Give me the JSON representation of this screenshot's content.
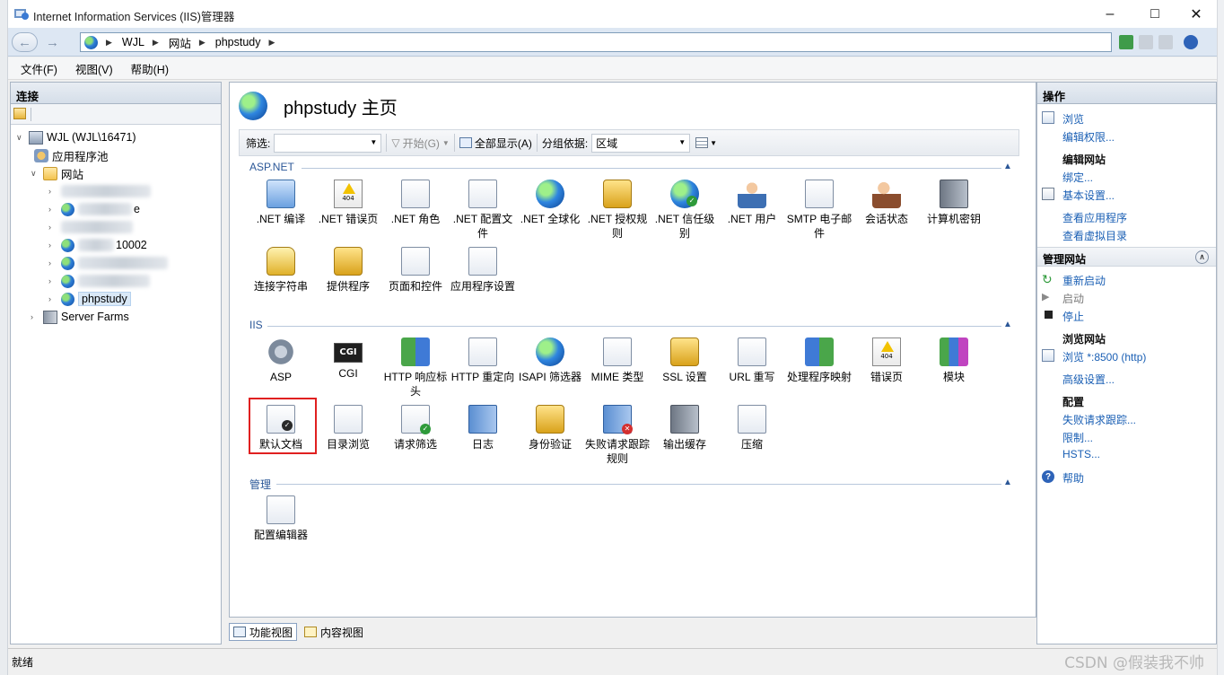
{
  "window": {
    "title": "Internet Information Services (IIS)管理器"
  },
  "address": {
    "crumbs": [
      "WJL",
      "网站",
      "phpstudy"
    ]
  },
  "menu": {
    "items": [
      "文件(F)",
      "视图(V)",
      "帮助(H)"
    ]
  },
  "connections": {
    "header": "连接",
    "server": "WJL (WJL\\16471)",
    "app_pools": "应用程序池",
    "sites": "网站",
    "site_partial_1": "e",
    "site_partial_2": "10002",
    "site_selected": "phpstudy",
    "server_farms": "Server Farms"
  },
  "center": {
    "title": "phpstudy 主页",
    "filter_label": "筛选:",
    "start_label": "开始(G)",
    "show_all_label": "全部显示(A)",
    "group_label": "分组依据:",
    "group_value": "区域",
    "sections": {
      "aspnet": "ASP.NET",
      "iis": "IIS",
      "manage": "管理"
    },
    "aspnet_features": [
      ".NET 编译",
      ".NET 错误页",
      ".NET 角色",
      ".NET 配置文件",
      ".NET 全球化",
      ".NET 授权规则",
      ".NET 信任级别",
      ".NET 用户",
      "SMTP 电子邮件",
      "会话状态",
      "计算机密钥",
      "连接字符串",
      "提供程序",
      "页面和控件",
      "应用程序设置"
    ],
    "iis_features": [
      "ASP",
      "CGI",
      "HTTP 响应标头",
      "HTTP 重定向",
      "ISAPI 筛选器",
      "MIME 类型",
      "SSL 设置",
      "URL 重写",
      "处理程序映射",
      "错误页",
      "模块",
      "默认文档",
      "目录浏览",
      "请求筛选",
      "日志",
      "身份验证",
      "失败请求跟踪规则",
      "输出缓存",
      "压缩"
    ],
    "manage_features": [
      "配置编辑器"
    ],
    "cgi_icon_text": "CGI"
  },
  "view_tabs": {
    "features": "功能视图",
    "content": "内容视图"
  },
  "actions": {
    "header": "操作",
    "browse": "浏览",
    "edit_permissions": "编辑权限...",
    "edit_site": "编辑网站",
    "bindings": "绑定...",
    "basic_settings": "基本设置...",
    "view_apps": "查看应用程序",
    "view_vdirs": "查看虚拟目录",
    "manage_site": "管理网站",
    "restart": "重新启动",
    "start": "启动",
    "stop": "停止",
    "browse_site": "浏览网站",
    "browse_port": "浏览 *:8500 (http)",
    "advanced": "高级设置...",
    "config": "配置",
    "failed_tracing": "失败请求跟踪...",
    "limits": "限制...",
    "hsts": "HSTS...",
    "help": "帮助"
  },
  "status": {
    "text": "就绪",
    "watermark": "CSDN @假装我不帅"
  },
  "colors": {
    "link": "#1a5fb4",
    "section": "#2b5797",
    "highlight": "#e02020"
  }
}
